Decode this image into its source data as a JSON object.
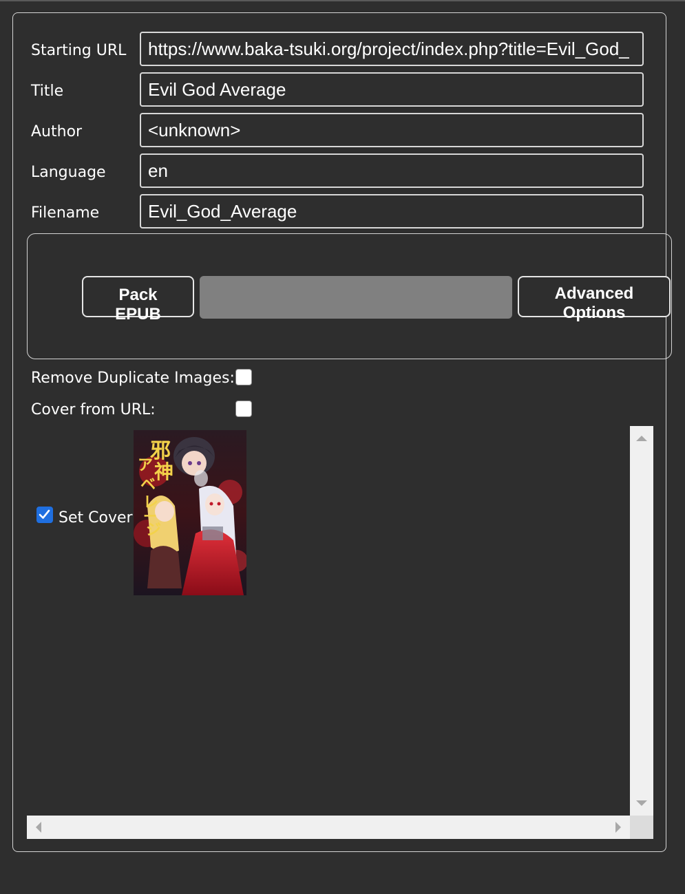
{
  "form": {
    "starting_url": {
      "label": "Starting URL",
      "value": "https://www.baka-tsuki.org/project/index.php?title=Evil_God_"
    },
    "title": {
      "label": "Title",
      "value": "Evil God Average"
    },
    "author": {
      "label": "Author",
      "value": "<unknown>"
    },
    "language": {
      "label": "Language",
      "value": "en"
    },
    "filename": {
      "label": "Filename",
      "value": "Evil_God_Average"
    }
  },
  "actions": {
    "pack_epub_line1": "Pack",
    "pack_epub_line2": "EPUB",
    "advanced_line1": "Advanced",
    "advanced_line2": "Options",
    "progress_fraction": 0
  },
  "options": {
    "remove_duplicates_label": "Remove Duplicate Images:",
    "remove_duplicates_checked": false,
    "cover_from_url_label": "Cover from URL:",
    "cover_from_url_checked": false
  },
  "images": {
    "set_cover_label": "Set Cover",
    "set_cover_checked": true,
    "cover_title_text": "邪神アベレージ"
  },
  "colors": {
    "background": "#2e2e2e",
    "border": "#d6d6d6",
    "progress": "#808080",
    "check_accent": "#1f6fe0"
  }
}
